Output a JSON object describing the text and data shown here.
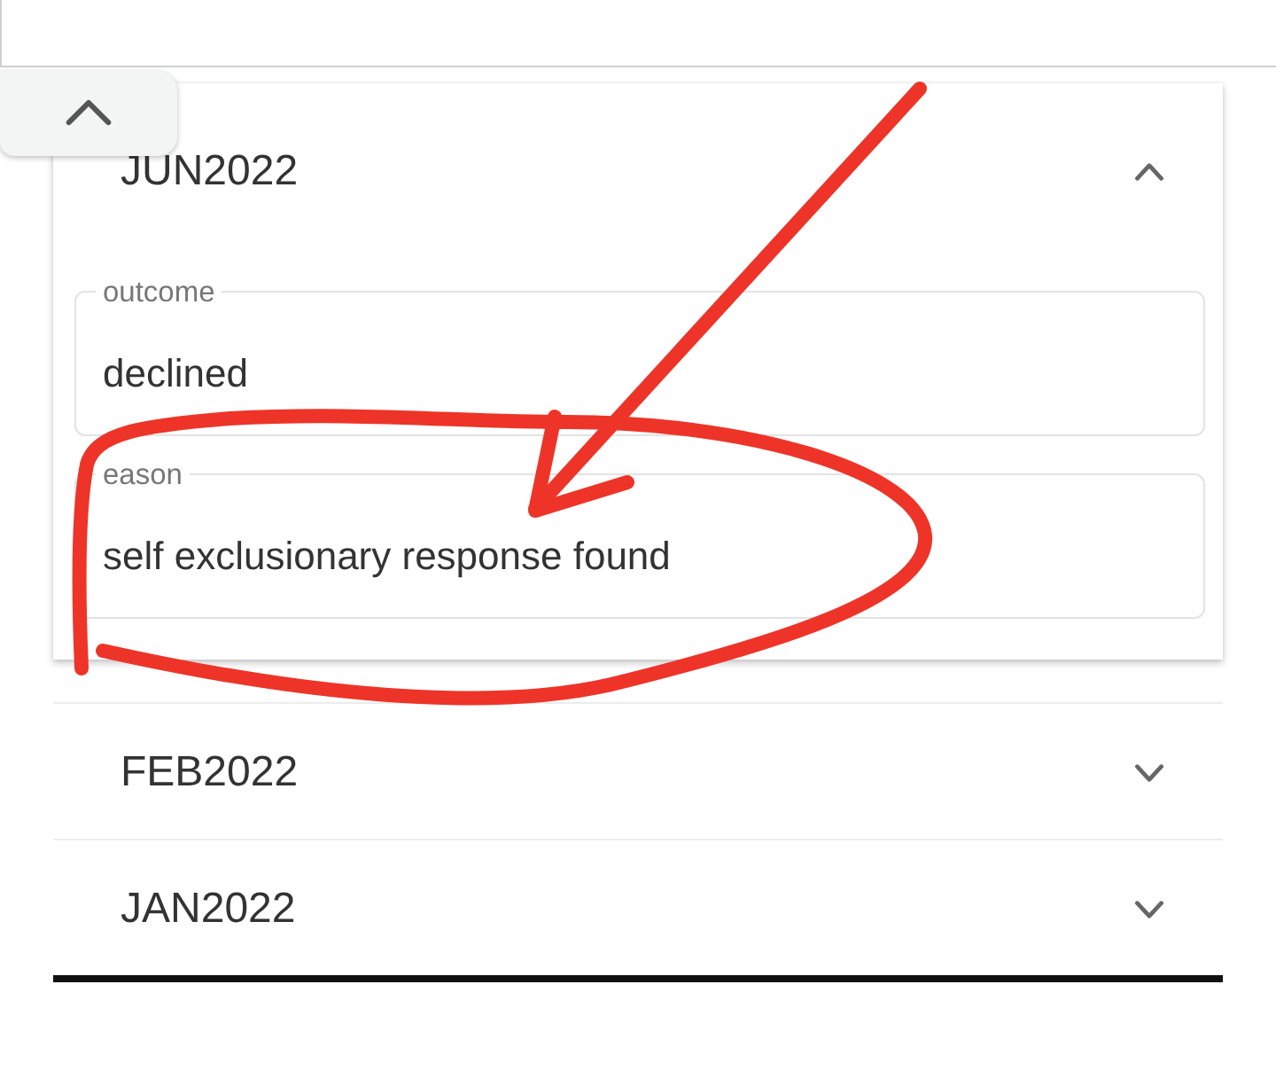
{
  "panels": [
    {
      "title": "JUN2022",
      "expanded": true,
      "fields": [
        {
          "label": "outcome",
          "value": "declined"
        },
        {
          "label": "eason",
          "value": "self exclusionary response found"
        }
      ]
    },
    {
      "title": "FEB2022",
      "expanded": false
    },
    {
      "title": "JAN2022",
      "expanded": false
    }
  ],
  "annotations": {
    "arrow": true,
    "loop": true
  }
}
